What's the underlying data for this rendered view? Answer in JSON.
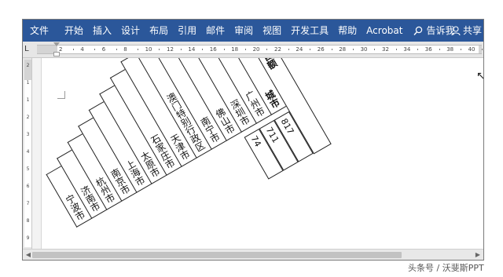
{
  "ribbon": {
    "tabs": [
      "文件",
      "开始",
      "插入",
      "设计",
      "布局",
      "引用",
      "邮件",
      "审阅",
      "视图",
      "开发工具",
      "帮助",
      "Acrobat"
    ],
    "tell_me": "告诉我",
    "share": "共享",
    "background": "#2b579a"
  },
  "hruler": {
    "corner": "L",
    "ticks": [
      "2",
      "4",
      "6",
      "8",
      "10",
      "12",
      "14",
      "16",
      "18",
      "20",
      "22",
      "24",
      "26",
      "28",
      "30",
      "32",
      "34",
      "36",
      "38",
      "40"
    ]
  },
  "vruler": {
    "ticks": [
      "2",
      "1",
      "1",
      "2",
      "3",
      "4",
      "5",
      "6",
      "7",
      "8",
      "9"
    ]
  },
  "table": {
    "header_city": "城市",
    "header_sales": "销售额",
    "cities": [
      "宁波市",
      "济南市",
      "杭州市",
      "南京市",
      "上海市",
      "太原市",
      "石家庄市",
      "天津市",
      "澳门特别行政区",
      "南宁市",
      "佛山市",
      "深圳市",
      "广州市"
    ],
    "sales": [
      "817",
      "711",
      "74"
    ]
  },
  "watermark": "头条号 / 沃斐斯PPT"
}
